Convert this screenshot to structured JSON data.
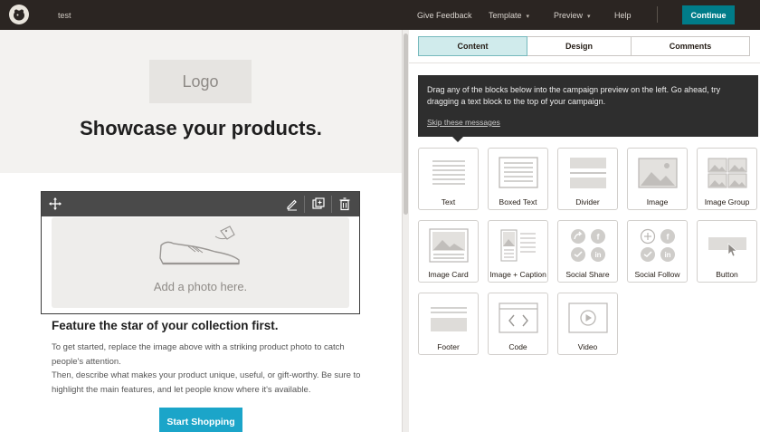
{
  "topbar": {
    "doc_title": "test",
    "nav": {
      "give_feedback": "Give Feedback",
      "template": "Template",
      "preview": "Preview",
      "help": "Help"
    },
    "continue_label": "Continue"
  },
  "preview": {
    "logo_placeholder": "Logo",
    "headline": "Showcase your products.",
    "photo_placeholder": "Add a photo here.",
    "feature_title": "Feature the star of your collection first.",
    "paragraph_1": "To get started, replace the image above with a striking product photo to catch people's attention.",
    "paragraph_2": "Then, describe what makes your product unique, useful, or gift-worthy. Be sure to highlight the main features, and let people know where it's available.",
    "cta_label": "Start Shopping"
  },
  "panel": {
    "tabs": [
      {
        "label": "Content",
        "active": true
      },
      {
        "label": "Design",
        "active": false
      },
      {
        "label": "Comments",
        "active": false
      }
    ],
    "tip": {
      "text": "Drag any of the blocks below into the campaign preview on the left. Go ahead, try dragging a text block to the top of your campaign.",
      "skip": "Skip these messages"
    },
    "blocks": [
      {
        "label": "Text",
        "icon": "text-block-icon"
      },
      {
        "label": "Boxed Text",
        "icon": "boxed-text-block-icon"
      },
      {
        "label": "Divider",
        "icon": "divider-block-icon"
      },
      {
        "label": "Image",
        "icon": "image-block-icon"
      },
      {
        "label": "Image Group",
        "icon": "image-group-block-icon"
      },
      {
        "label": "Image Card",
        "icon": "image-card-block-icon"
      },
      {
        "label": "Image + Caption",
        "icon": "image-caption-block-icon"
      },
      {
        "label": "Social Share",
        "icon": "social-share-block-icon"
      },
      {
        "label": "Social Follow",
        "icon": "social-follow-block-icon"
      },
      {
        "label": "Button",
        "icon": "button-block-icon"
      },
      {
        "label": "Footer",
        "icon": "footer-block-icon"
      },
      {
        "label": "Code",
        "icon": "code-block-icon"
      },
      {
        "label": "Video",
        "icon": "video-block-icon"
      }
    ]
  },
  "colors": {
    "topbar_bg": "#2b2522",
    "accent_teal": "#007c89",
    "cta_blue": "#1ba5c9",
    "active_tab_bg": "#d0ebec",
    "tip_bg": "#2e2e2e"
  }
}
